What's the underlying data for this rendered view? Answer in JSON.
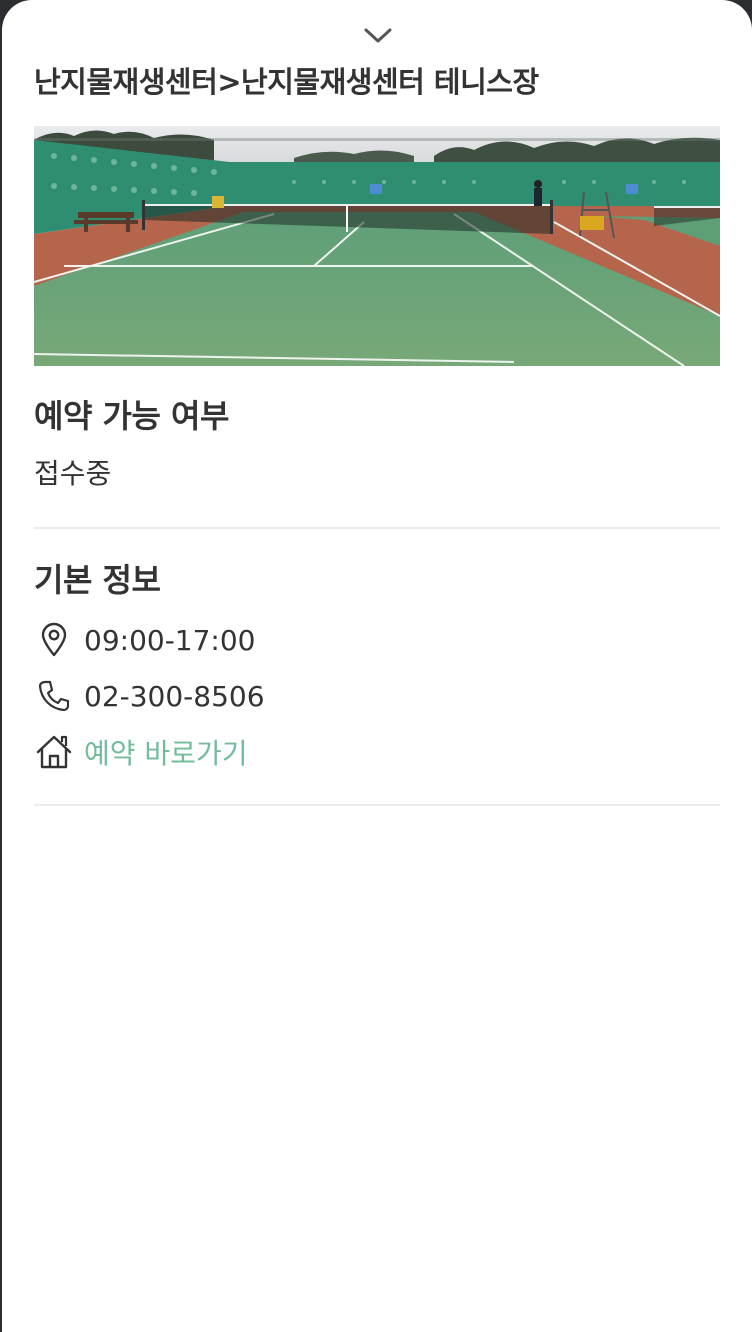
{
  "header": {
    "collapse_icon": "chevron-down-icon",
    "title": "난지물재생센터>난지물재생센터 테니스장"
  },
  "photo": {
    "subject": "tennis court"
  },
  "availability": {
    "title": "예약 가능 여부",
    "status": "접수중"
  },
  "basic_info": {
    "title": "기본 정보",
    "hours_icon": "location-pin-icon",
    "hours": "09:00-17:00",
    "phone_icon": "phone-icon",
    "phone": "02-300-8506",
    "reservation_icon": "home-icon",
    "reservation_link": "예약 바로가기"
  },
  "colors": {
    "link": "#72bc9c",
    "text": "#333333",
    "divider": "#ececec"
  }
}
